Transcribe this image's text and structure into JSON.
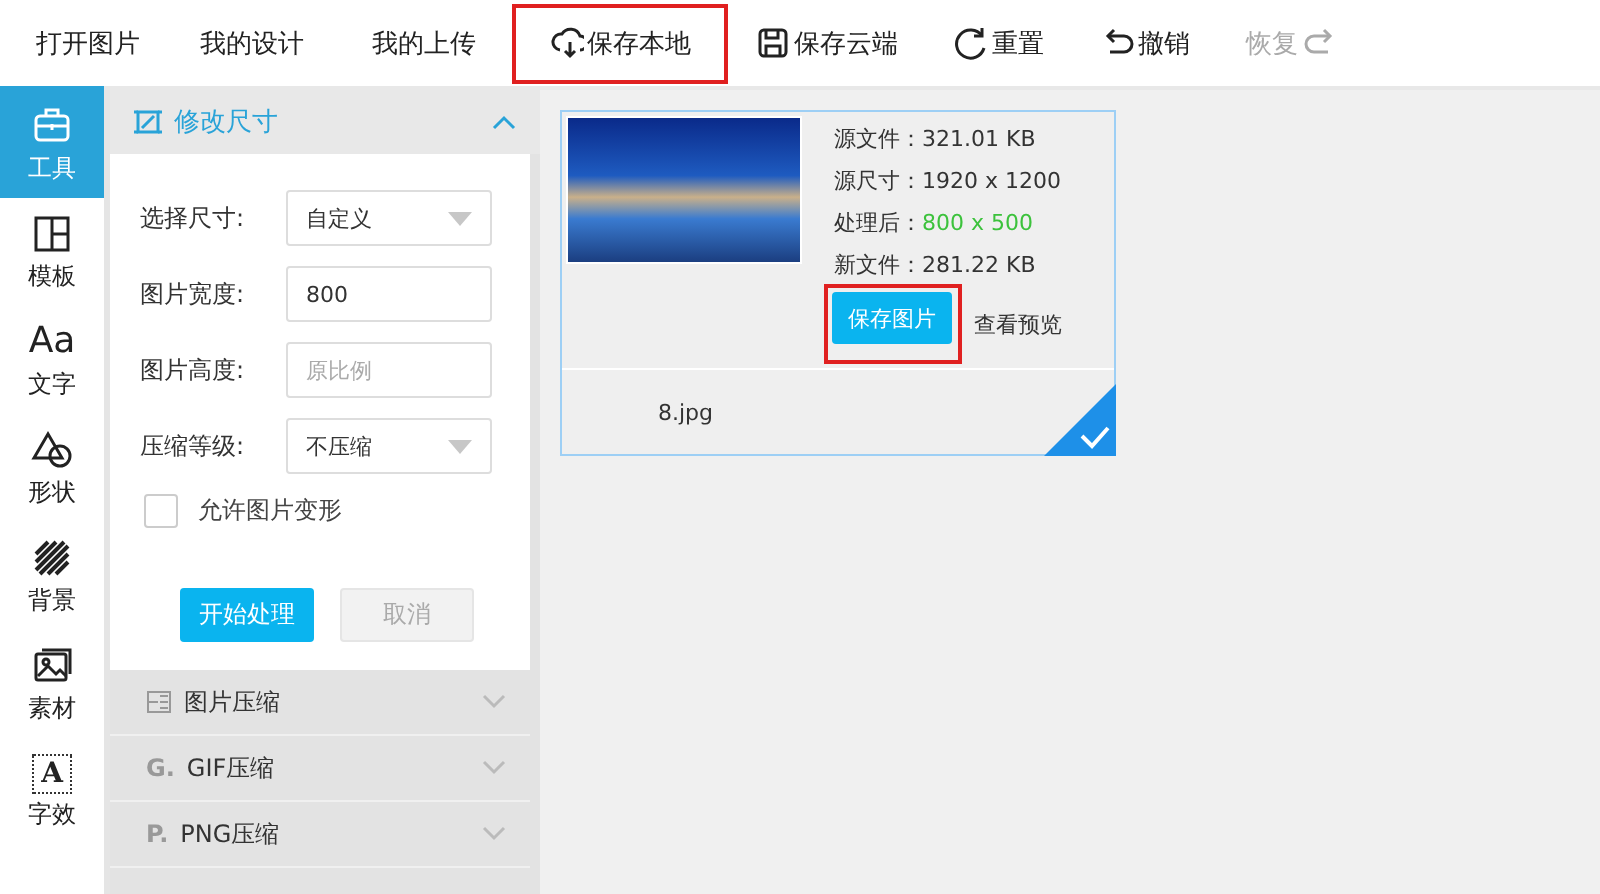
{
  "toolbar": [
    {
      "label": "打开图片",
      "disabled": false,
      "highlighted": false
    },
    {
      "label": "我的设计",
      "disabled": false,
      "highlighted": false
    },
    {
      "label": "我的上传",
      "disabled": false,
      "highlighted": false
    },
    {
      "label": "保存本地",
      "disabled": false,
      "highlighted": true
    },
    {
      "label": "保存云端",
      "disabled": false,
      "highlighted": false
    },
    {
      "label": "重置",
      "disabled": false,
      "highlighted": false
    },
    {
      "label": "撤销",
      "disabled": false,
      "highlighted": false
    },
    {
      "label": "恢复",
      "disabled": true,
      "highlighted": false
    }
  ],
  "sidebar": {
    "items": [
      {
        "label": "工具",
        "selected": true
      },
      {
        "label": "模板",
        "selected": false
      },
      {
        "label": "文字",
        "glyph": "Aa",
        "selected": false
      },
      {
        "label": "形状",
        "selected": false
      },
      {
        "label": "背景",
        "selected": false
      },
      {
        "label": "素材",
        "selected": false
      },
      {
        "label": "字效",
        "glyph": "A",
        "selected": false
      }
    ]
  },
  "panel": {
    "title": "修改尺寸",
    "expanded": true,
    "fields": [
      {
        "label": "选择尺寸:",
        "kind": "select",
        "value": "自定义"
      },
      {
        "label": "图片宽度:",
        "kind": "input",
        "value": "800"
      },
      {
        "label": "图片高度:",
        "kind": "input",
        "placeholder": "原比例"
      },
      {
        "label": "压缩等级:",
        "kind": "select",
        "value": "不压缩"
      }
    ],
    "checkbox": {
      "label": "允许图片变形",
      "checked": false
    },
    "buttons": [
      {
        "label": "开始处理",
        "disabled": false
      },
      {
        "label": "取消",
        "disabled": true
      }
    ]
  },
  "sections": [
    {
      "label": "图片压缩",
      "expanded": false
    },
    {
      "prefix": "G.",
      "label": "GIF压缩",
      "expanded": false
    },
    {
      "prefix": "P.",
      "label": "PNG压缩",
      "expanded": false
    }
  ],
  "card": {
    "selected": true,
    "info": [
      {
        "label": "源文件：",
        "value": "321.01 KB",
        "highlight": false
      },
      {
        "label": "源尺寸：",
        "value": "1920 x 1200",
        "highlight": false
      },
      {
        "label": "处理后：",
        "value": "800 x 500",
        "highlight": true
      },
      {
        "label": "新文件：",
        "value": "281.22 KB",
        "highlight": false
      }
    ],
    "save_button": {
      "label": "保存图片",
      "highlighted": true
    },
    "preview_link": "查看预览",
    "filename": "8.jpg"
  }
}
